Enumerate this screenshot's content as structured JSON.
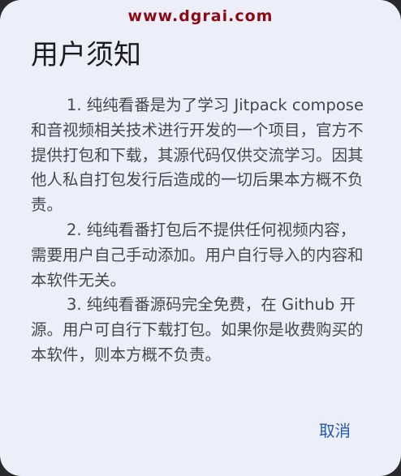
{
  "watermark": "www.dgrai.com",
  "dialog": {
    "title": "用户须知",
    "paragraphs": [
      "1. 纯纯看番是为了学习 Jitpack compose 和音视频相关技术进行开发的一个项目，官方不提供打包和下载，其源代码仅供交流学习。因其他人私自打包发行后造成的一切后果本方概不负责。",
      "2. 纯纯看番打包后不提供任何视频内容，需要用户自己手动添加。用户自行导入的内容和本软件无关。",
      "3. 纯纯看番源码完全免费，在 Github 开源。用户可自行下载打包。如果你是收费购买的本软件，则本方概不负责。"
    ],
    "cancel_label": "取消"
  },
  "colors": {
    "dialog_bg": "#eceff9",
    "title": "#1b1b1f",
    "body_text": "#44474f",
    "accent": "#2456b3",
    "watermark": "#8b0a14"
  }
}
